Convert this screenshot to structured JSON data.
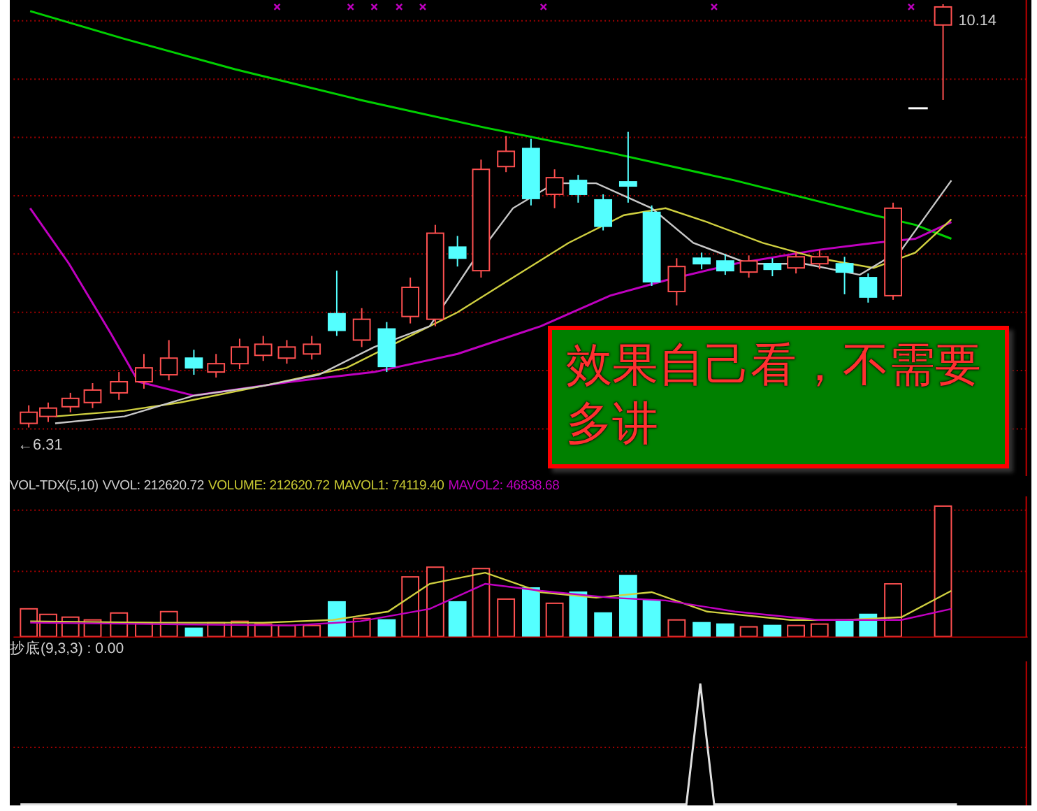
{
  "price_chart": {
    "high_label": "10.14",
    "low_label": "←6.31",
    "note": "效果自己看，不需要多讲"
  },
  "volume_indicator": {
    "name": "VOL-TDX(5,10)",
    "readings": [
      {
        "text": "VVOL: 212620.72",
        "color": "#d0d0d0"
      },
      {
        "text": "VOLUME: 212620.72",
        "color": "#c8c832"
      },
      {
        "text": "MAVOL1: 74119.40",
        "color": "#c8c832"
      },
      {
        "text": "MAVOL2: 46838.68",
        "color": "#c000c0"
      }
    ]
  },
  "bottom_indicator": {
    "label": "抄底(9,3,3) : 0.00"
  }
}
